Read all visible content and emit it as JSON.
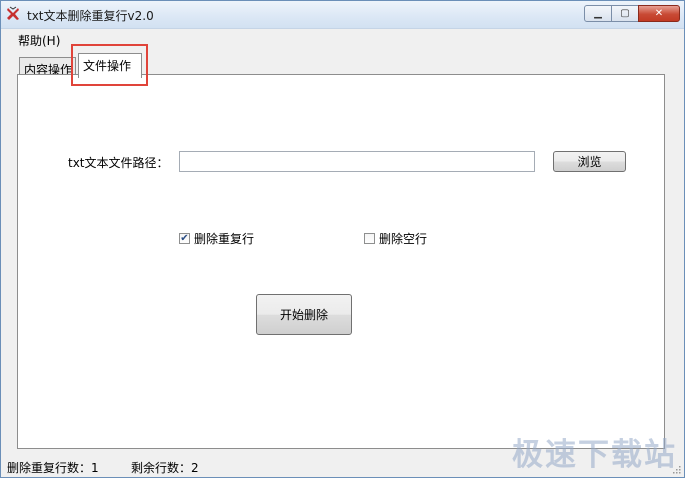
{
  "window": {
    "title": "txt文本删除重复行v2.0",
    "minimize_symbol": "▁",
    "maximize_symbol": "▢",
    "close_symbol": "✕"
  },
  "menu": {
    "help": "帮助(H)"
  },
  "tabs": [
    {
      "label": "内容操作",
      "selected": false
    },
    {
      "label": "文件操作",
      "selected": true
    }
  ],
  "file_tab": {
    "path_label": "txt文本文件路径：",
    "path_value": "",
    "browse_label": "浏览",
    "remove_duplicates_label": "删除重复行",
    "remove_duplicates_checked": true,
    "remove_empty_label": "删除空行",
    "remove_empty_checked": false,
    "start_label": "开始删除"
  },
  "status": {
    "duplicates": "删除重复行数：1",
    "remaining": "剩余行数：2"
  },
  "watermark": "极速下载站",
  "colors": {
    "highlight": "#e0443a",
    "title_gradient": "#dbe7f5",
    "close_button": "#c84a35"
  }
}
